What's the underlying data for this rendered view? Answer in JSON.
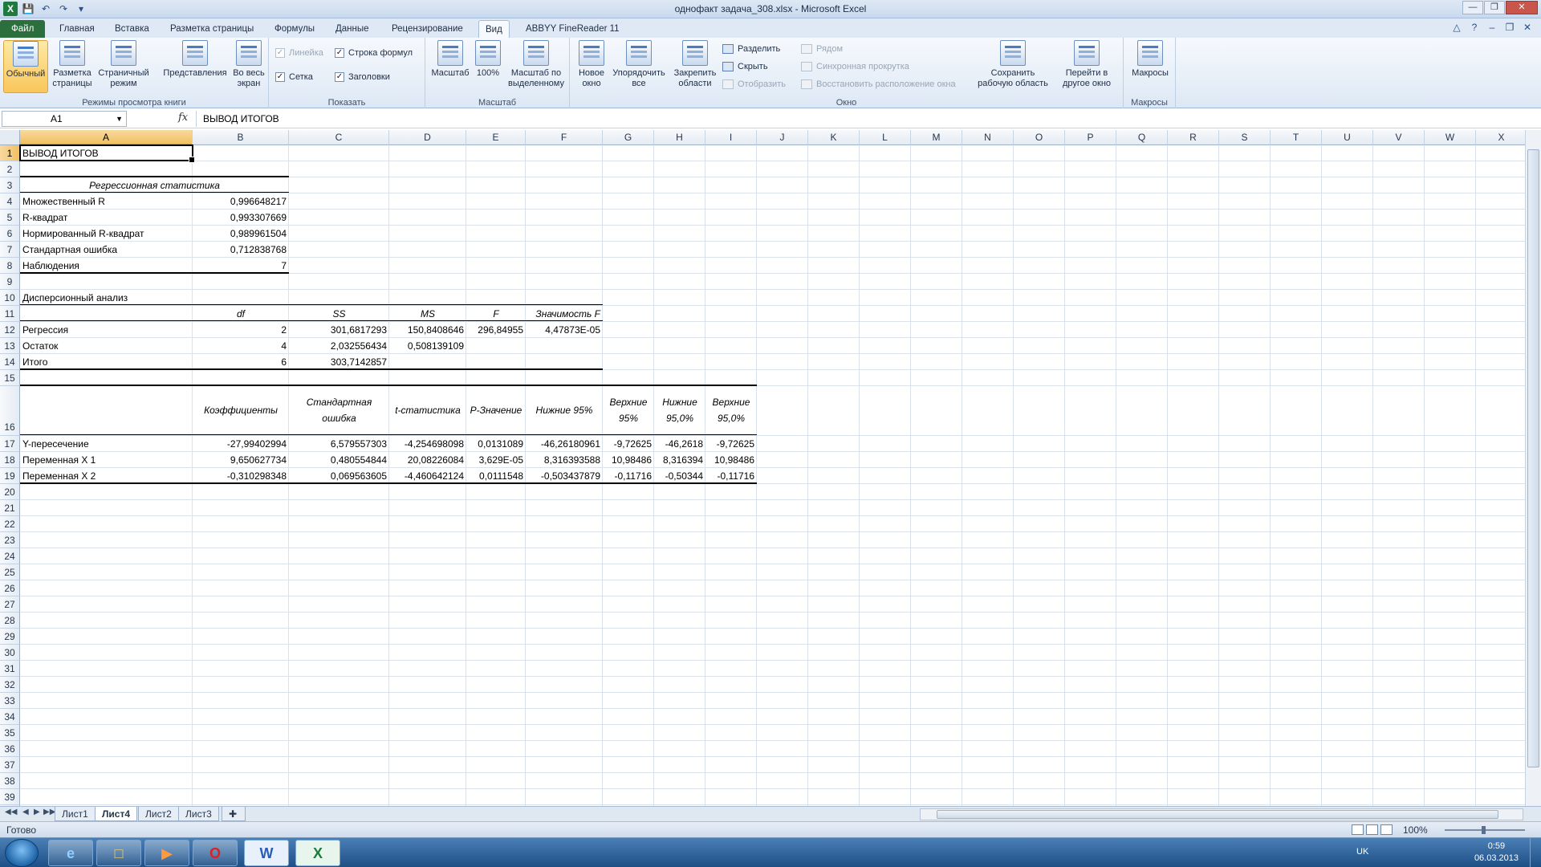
{
  "window": {
    "title": "однофакт задача_308.xlsx - Microsoft Excel"
  },
  "tabs": [
    "Файл",
    "Главная",
    "Вставка",
    "Разметка страницы",
    "Формулы",
    "Данные",
    "Рецензирование",
    "Вид",
    "ABBYY FineReader 11"
  ],
  "ribbon": {
    "group1": {
      "label": "Режимы просмотра книги",
      "buttons": [
        "Обычный",
        "Разметка страницы",
        "Страничный режим",
        "Представления",
        "Во весь экран"
      ]
    },
    "group2": {
      "label": "Показать",
      "checks": [
        "Линейка",
        "Строка формул",
        "Сетка",
        "Заголовки"
      ]
    },
    "group3": {
      "label": "Масштаб",
      "buttons": [
        "Масштаб",
        "100%",
        "Масштаб по выделенному"
      ]
    },
    "group4": {
      "label": "Окно",
      "buttons": [
        "Новое окно",
        "Упорядочить все",
        "Закрепить области"
      ],
      "small": [
        "Разделить",
        "Скрыть",
        "Отобразить",
        "Рядом",
        "Синхронная прокрутка",
        "Восстановить расположение окна"
      ],
      "big2": [
        "Сохранить рабочую область",
        "Перейти в другое окно"
      ]
    },
    "group5": {
      "label": "Макросы",
      "buttons": [
        "Макросы"
      ]
    }
  },
  "formula_bar": {
    "name_box": "A1",
    "fx": "fx",
    "content": "ВЫВОД ИТОГОВ"
  },
  "columns": [
    "A",
    "B",
    "C",
    "D",
    "E",
    "F",
    "G",
    "H",
    "I",
    "J",
    "K",
    "L",
    "M",
    "N",
    "O",
    "P",
    "Q",
    "R",
    "S",
    "T",
    "U",
    "V",
    "W",
    "X"
  ],
  "cells": {
    "a1": "ВЫВОД ИТОГОВ",
    "a3": "Регрессионная статистика",
    "a4": "Множественный R",
    "b4": "0,996648217",
    "a5": "R-квадрат",
    "b5": "0,993307669",
    "a6": "Нормированный R-квадрат",
    "b6": "0,989961504",
    "a7": "Стандартная ошибка",
    "b7": "0,712838768",
    "a8": "Наблюдения",
    "b8": "7",
    "a10": "Дисперсионный анализ",
    "b11": "df",
    "c11": "SS",
    "d11": "MS",
    "e11": "F",
    "f11": "Значимость F",
    "a12": "Регрессия",
    "b12": "2",
    "c12": "301,6817293",
    "d12": "150,8408646",
    "e12": "296,84955",
    "f12": "4,47873E-05",
    "a13": "Остаток",
    "b13": "4",
    "c13": "2,032556434",
    "d13": "0,508139109",
    "a14": "Итого",
    "b14": "6",
    "c14": "303,7142857",
    "b16": "Коэффициенты",
    "c16": "Стандартная ошибка",
    "d16": "t-статистика",
    "e16": "P-Значение",
    "f16": "Нижние 95%",
    "g16": "Верхние 95%",
    "h16": "Нижние 95,0%",
    "i16": "Верхние 95,0%",
    "a17": "Y-пересечение",
    "b17": "-27,99402994",
    "c17": "6,579557303",
    "d17": "-4,254698098",
    "e17": "0,0131089",
    "f17": "-46,26180961",
    "g17": "-9,72625",
    "h17": "-46,2618",
    "i17": "-9,72625",
    "a18": "Переменная X 1",
    "b18": "9,650627734",
    "c18": "0,480554844",
    "d18": "20,08226084",
    "e18": "3,629E-05",
    "f18": "8,316393588",
    "g18": "10,98486",
    "h18": "8,316394",
    "i18": "10,98486",
    "a19": "Переменная X 2",
    "b19": "-0,310298348",
    "c19": "0,069563605",
    "d19": "-4,460642124",
    "e19": "0,0111548",
    "f19": "-0,503437879",
    "g19": "-0,11716",
    "h19": "-0,50344",
    "i19": "-0,11716"
  },
  "sheets": [
    "Лист1",
    "Лист4",
    "Лист2",
    "Лист3"
  ],
  "status": {
    "ready": "Готово",
    "zoom": "100%"
  },
  "taskbar": {
    "lang": "UK",
    "time": "0:59",
    "date": "06.03.2013"
  }
}
